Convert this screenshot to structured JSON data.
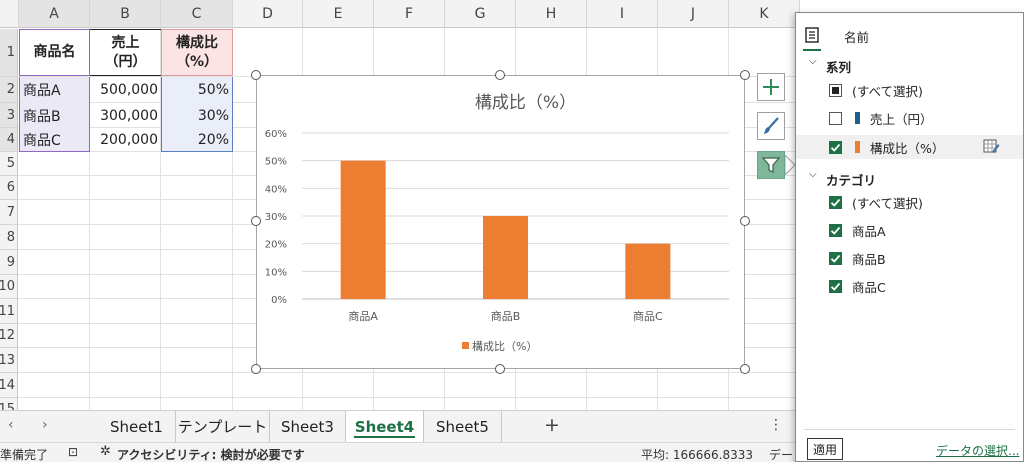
{
  "grid": {
    "columns": [
      "A",
      "B",
      "C",
      "D",
      "E",
      "F",
      "G",
      "H",
      "I",
      "J",
      "K"
    ],
    "rows": [
      "1",
      "2",
      "3",
      "4",
      "5",
      "6",
      "7",
      "8",
      "9",
      "10",
      "11",
      "12",
      "13",
      "14",
      "15"
    ],
    "headers": {
      "a1": "商品名",
      "b1_line1": "売上",
      "b1_line2": "（円）",
      "c1_line1": "構成比",
      "c1_line2": "（%）"
    },
    "data": [
      {
        "name": "商品A",
        "sales": "500,000",
        "ratio": "50%"
      },
      {
        "name": "商品B",
        "sales": "300,000",
        "ratio": "30%"
      },
      {
        "name": "商品C",
        "sales": "200,000",
        "ratio": "20%"
      }
    ]
  },
  "chart_data": {
    "type": "bar",
    "title": "構成比（%）",
    "categories": [
      "商品A",
      "商品B",
      "商品C"
    ],
    "series": [
      {
        "name": "構成比（%）",
        "values": [
          0.5,
          0.3,
          0.2
        ],
        "color": "#ed7d31"
      }
    ],
    "yticks": [
      "0%",
      "10%",
      "20%",
      "30%",
      "40%",
      "50%",
      "60%"
    ],
    "ylim": [
      0,
      0.6
    ],
    "grid": true,
    "legend": "bottom"
  },
  "chart_buttons": {
    "elements": "plus-icon",
    "styles": "brush-icon",
    "filter": "funnel-icon"
  },
  "sheets": {
    "tabs": [
      "Sheet1",
      "テンプレート",
      "Sheet3",
      "Sheet4",
      "Sheet5"
    ],
    "active": "Sheet4",
    "add": "+",
    "more": "⋮"
  },
  "status": {
    "ready": "準備完了",
    "accessibility": "アクセシビリティ: 検討が必要です",
    "average": "平均: 166666.8333",
    "trailing": "デー"
  },
  "pane": {
    "tab_label": "名前",
    "series_heading": "系列",
    "series_items": [
      "(すべて選択)",
      "売上（円）",
      "構成比（%）"
    ],
    "series_colors": [
      "",
      "#1f5f8b",
      "#ed7d31"
    ],
    "category_heading": "カテゴリ",
    "category_items": [
      "(すべて選択)",
      "商品A",
      "商品B",
      "商品C"
    ],
    "apply_label": "適用",
    "select_data_link": "データの選択..."
  },
  "colors": {
    "accent": "#1e7145",
    "bar": "#ed7d31",
    "header_fill": "#e7e6f5",
    "ratio_fill": "#e9eef8"
  }
}
